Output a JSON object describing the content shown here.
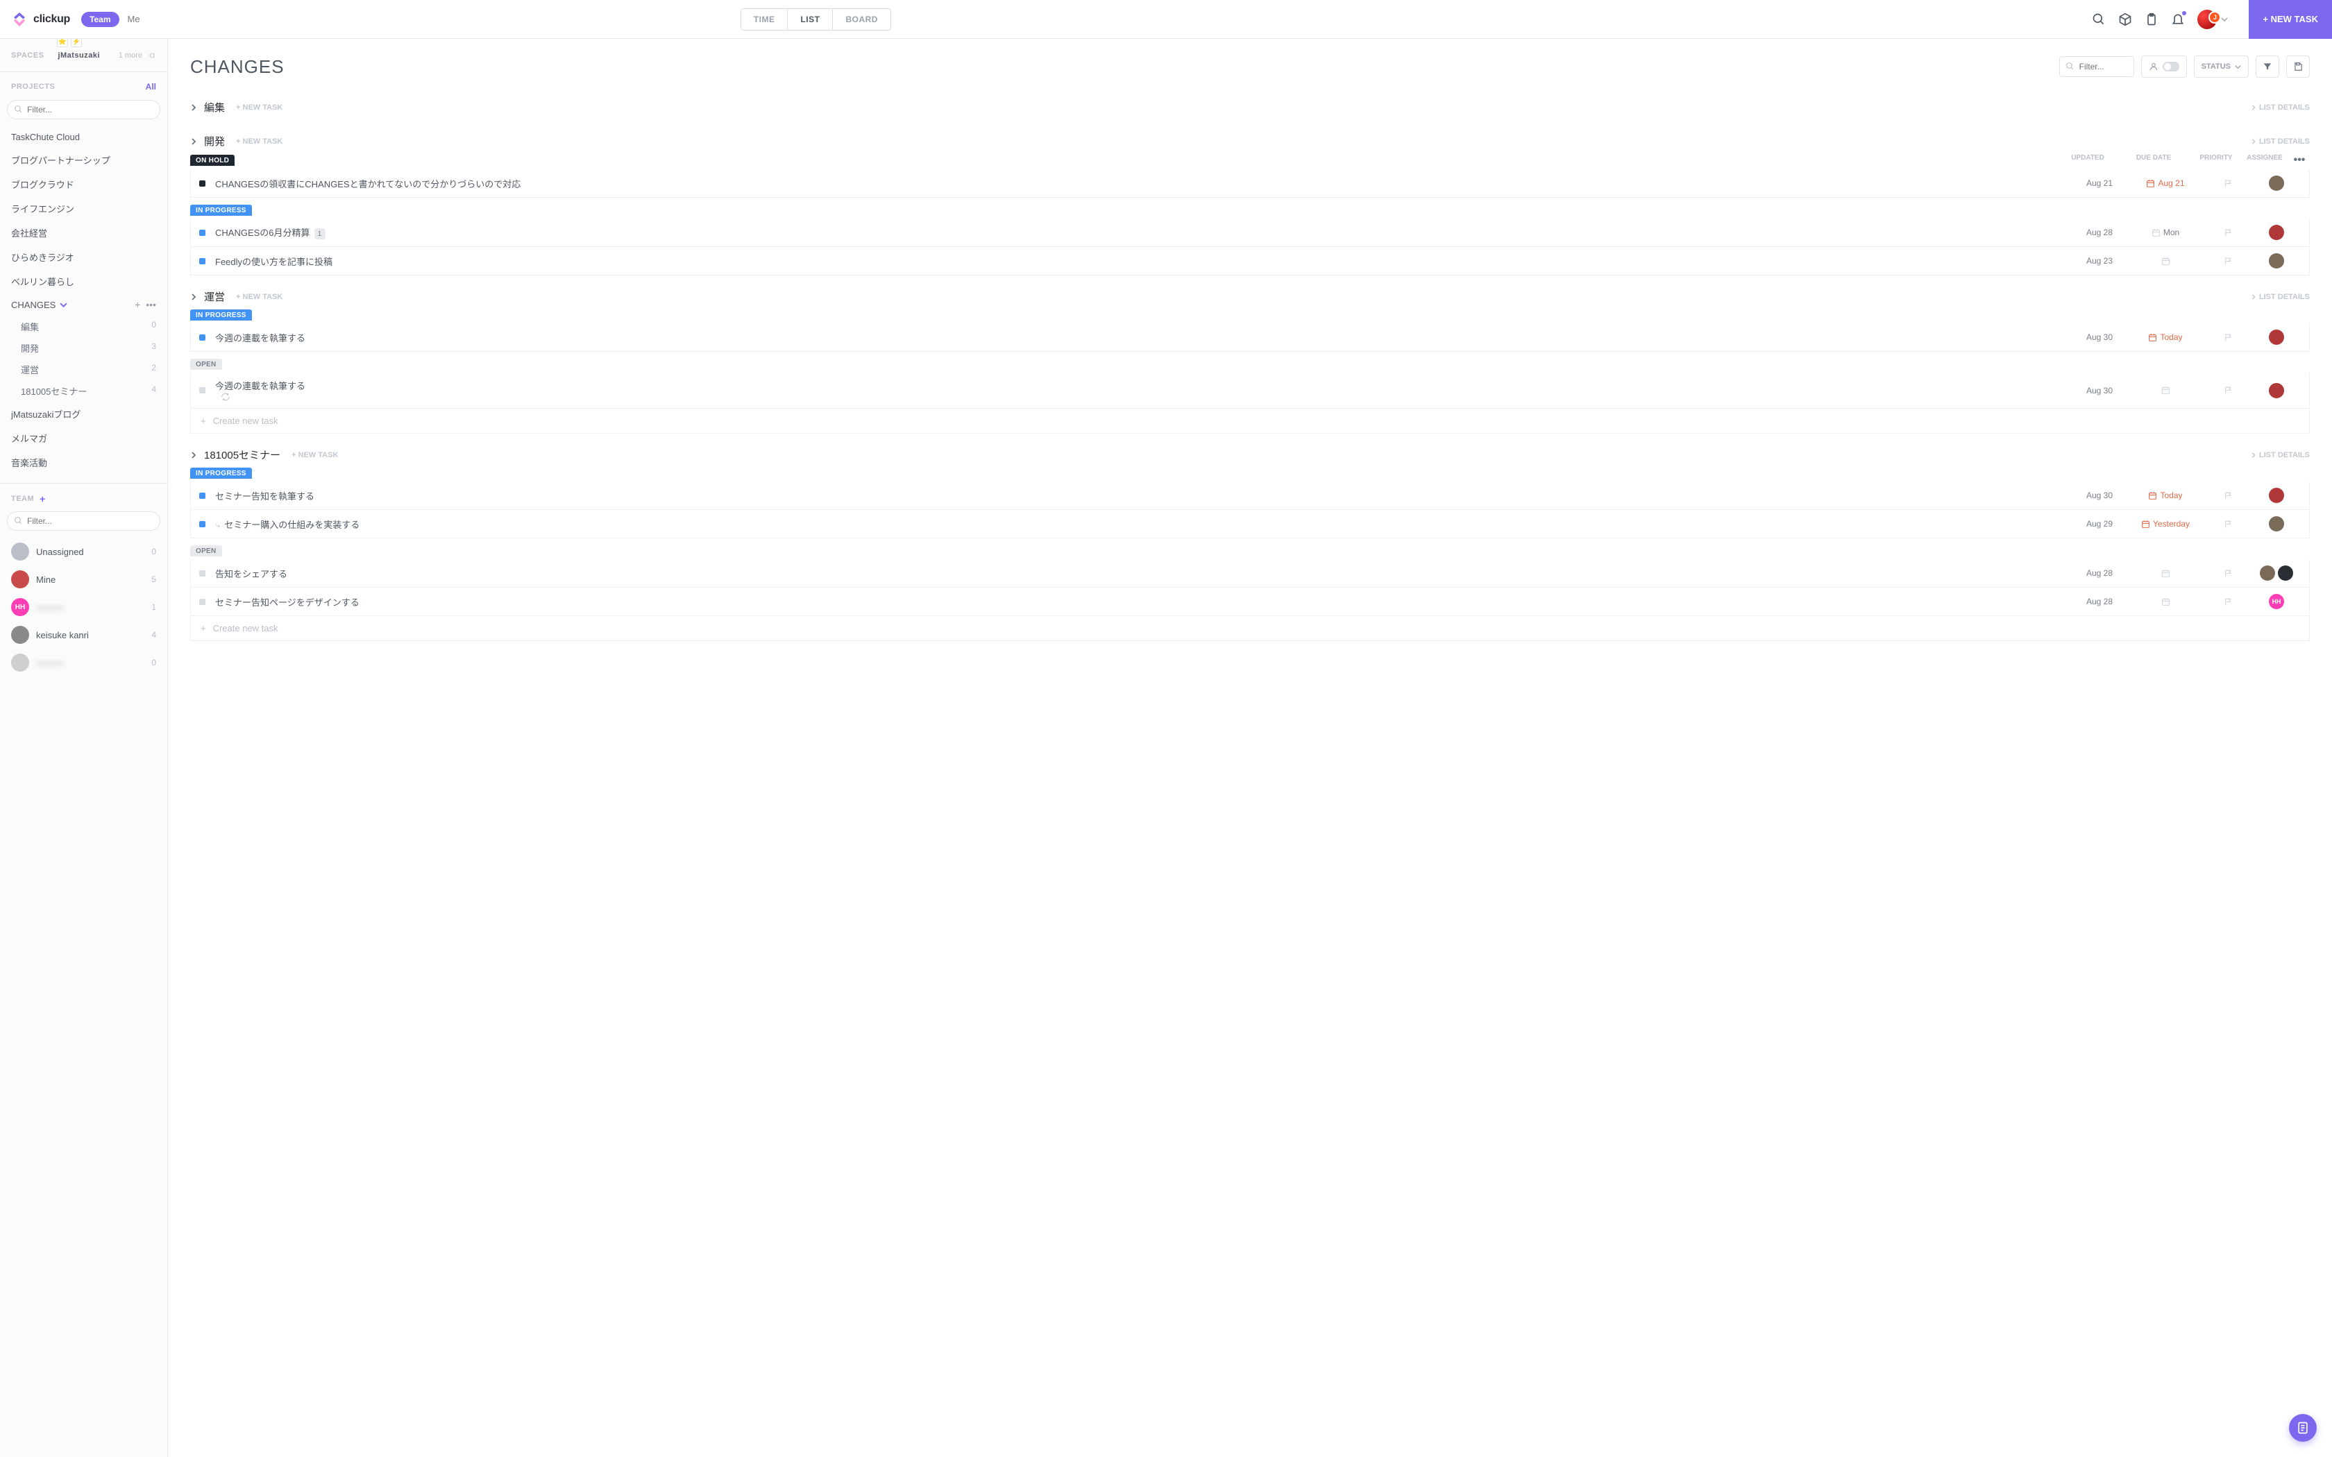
{
  "header": {
    "brand": "clickup",
    "team_pill": "Team",
    "me_pill": "Me",
    "views": {
      "time": "TIME",
      "list": "LIST",
      "board": "BOARD"
    },
    "new_task_btn": "+ NEW TASK"
  },
  "sidebar": {
    "tabs": {
      "spaces": "SPACES",
      "active": "jMatsuzaki",
      "more": "1 more"
    },
    "projects_label": "PROJECTS",
    "all_link": "All",
    "filter_placeholder": "Filter...",
    "projects": [
      {
        "name": "TaskChute Cloud"
      },
      {
        "name": "ブログパートナーシップ"
      },
      {
        "name": "ブログクラウド"
      },
      {
        "name": "ライフエンジン"
      },
      {
        "name": "会社経営"
      },
      {
        "name": "ひらめきラジオ"
      },
      {
        "name": "ベルリン暮らし"
      }
    ],
    "expanded": {
      "name": "CHANGES",
      "subs": [
        {
          "name": "編集",
          "count": "0"
        },
        {
          "name": "開発",
          "count": "3"
        },
        {
          "name": "運営",
          "count": "2"
        },
        {
          "name": "181005セミナー",
          "count": "4"
        }
      ]
    },
    "projects_after": [
      {
        "name": "jMatsuzakiブログ"
      },
      {
        "name": "メルマガ"
      },
      {
        "name": "音楽活動"
      }
    ],
    "team_label": "TEAM",
    "team_filter_placeholder": "Filter...",
    "team": [
      {
        "name": "Unassigned",
        "count": "0",
        "color": "#b9bec7",
        "initials": ""
      },
      {
        "name": "Mine",
        "count": "5",
        "color": "#c94a4a",
        "initials": ""
      },
      {
        "name": "———",
        "count": "1",
        "color": "#ff3db5",
        "initials": "HH",
        "blur": true
      },
      {
        "name": "keisuke kanri",
        "count": "4",
        "color": "#8a8a8a",
        "initials": ""
      },
      {
        "name": "———",
        "count": "0",
        "color": "#cfcfcf",
        "initials": "",
        "blur": true
      }
    ]
  },
  "main": {
    "title": "CHANGES",
    "search_placeholder": "Filter...",
    "status_label": "STATUS",
    "new_task_label": "+ NEW TASK",
    "list_details_label": "LIST DETAILS",
    "create_task_label": "Create new task",
    "col_headers": {
      "updated": "UPDATED",
      "due": "DUE DATE",
      "priority": "PRIORITY",
      "assignee": "ASSIGNEE"
    },
    "groups": [
      {
        "name": "編集",
        "collapsed": true
      },
      {
        "name": "開発",
        "collapsed_head": true,
        "statuses": [
          {
            "label": "ON HOLD",
            "kind": "on-hold",
            "show_headers": true,
            "tasks": [
              {
                "title": "CHANGESの領収書にCHANGESと書かれてないので分かりづらいので対応",
                "updated": "Aug 21",
                "due": "Aug 21",
                "due_hot": true,
                "avatar": {
                  "color": "#7a6a5a"
                }
              }
            ]
          },
          {
            "label": "IN PROGRESS",
            "kind": "in-progress",
            "tasks": [
              {
                "title": "CHANGESの6月分精算",
                "badge": "1",
                "updated": "Aug 28",
                "due": "Mon",
                "avatar": {
                  "color": "#b03838"
                }
              },
              {
                "title": "Feedlyの使い方を記事に投稿",
                "updated": "Aug 23",
                "avatar": {
                  "color": "#7a6a5a"
                }
              }
            ]
          }
        ]
      },
      {
        "name": "運営",
        "collapsed_head": true,
        "statuses": [
          {
            "label": "IN PROGRESS",
            "kind": "in-progress",
            "tasks": [
              {
                "title": "今週の連載を執筆する",
                "updated": "Aug 30",
                "due": "Today",
                "due_hot": true,
                "avatar": {
                  "color": "#b03838"
                }
              }
            ]
          },
          {
            "label": "OPEN",
            "kind": "open",
            "tasks": [
              {
                "title": "今週の連載を執筆する",
                "recurrent": true,
                "updated": "Aug 30",
                "avatar": {
                  "color": "#b03838"
                }
              }
            ],
            "create_row": true
          }
        ]
      },
      {
        "name": "181005セミナー",
        "collapsed_head": true,
        "statuses": [
          {
            "label": "IN PROGRESS",
            "kind": "in-progress",
            "tasks": [
              {
                "title": "セミナー告知を執筆する",
                "updated": "Aug 30",
                "due": "Today",
                "due_hot": true,
                "avatar": {
                  "color": "#b03838"
                }
              },
              {
                "title": "セミナー購入の仕組みを実装する",
                "sub": true,
                "updated": "Aug 29",
                "due": "Yesterday",
                "due_hot": true,
                "avatar": {
                  "color": "#7a6a5a"
                }
              }
            ]
          },
          {
            "label": "OPEN",
            "kind": "open",
            "tasks": [
              {
                "title": "告知をシェアする",
                "updated": "Aug 28",
                "avatars": [
                  {
                    "color": "#7a6a5a"
                  },
                  {
                    "color": "#2a2e34"
                  }
                ]
              },
              {
                "title": "セミナー告知ページをデザインする",
                "updated": "Aug 28",
                "avatar": {
                  "color": "#ff3db5",
                  "initials": "HH"
                }
              }
            ],
            "create_row": true
          }
        ]
      }
    ]
  }
}
